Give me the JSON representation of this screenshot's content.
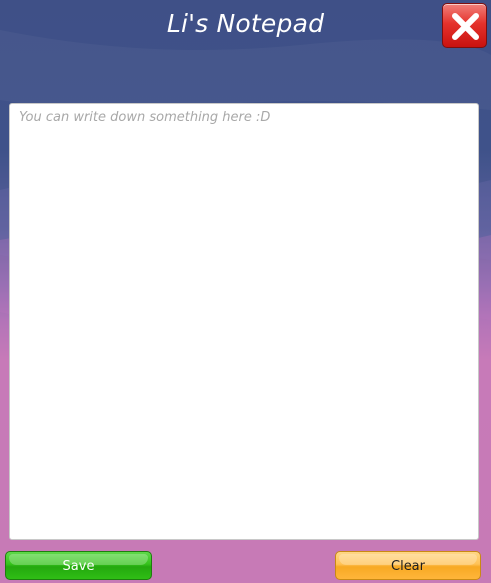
{
  "window": {
    "title": "Li's Notepad"
  },
  "close_button": {
    "icon": "close-icon",
    "color": "#e5322c"
  },
  "notepad": {
    "value": "",
    "placeholder": "You can write down something here :D"
  },
  "actions": {
    "save_label": "Save",
    "clear_label": "Clear"
  },
  "colors": {
    "header_blue": "#3f5087",
    "background_pink": "#c77ab6",
    "save_green": "#35c21b",
    "clear_orange": "#ffc255"
  }
}
